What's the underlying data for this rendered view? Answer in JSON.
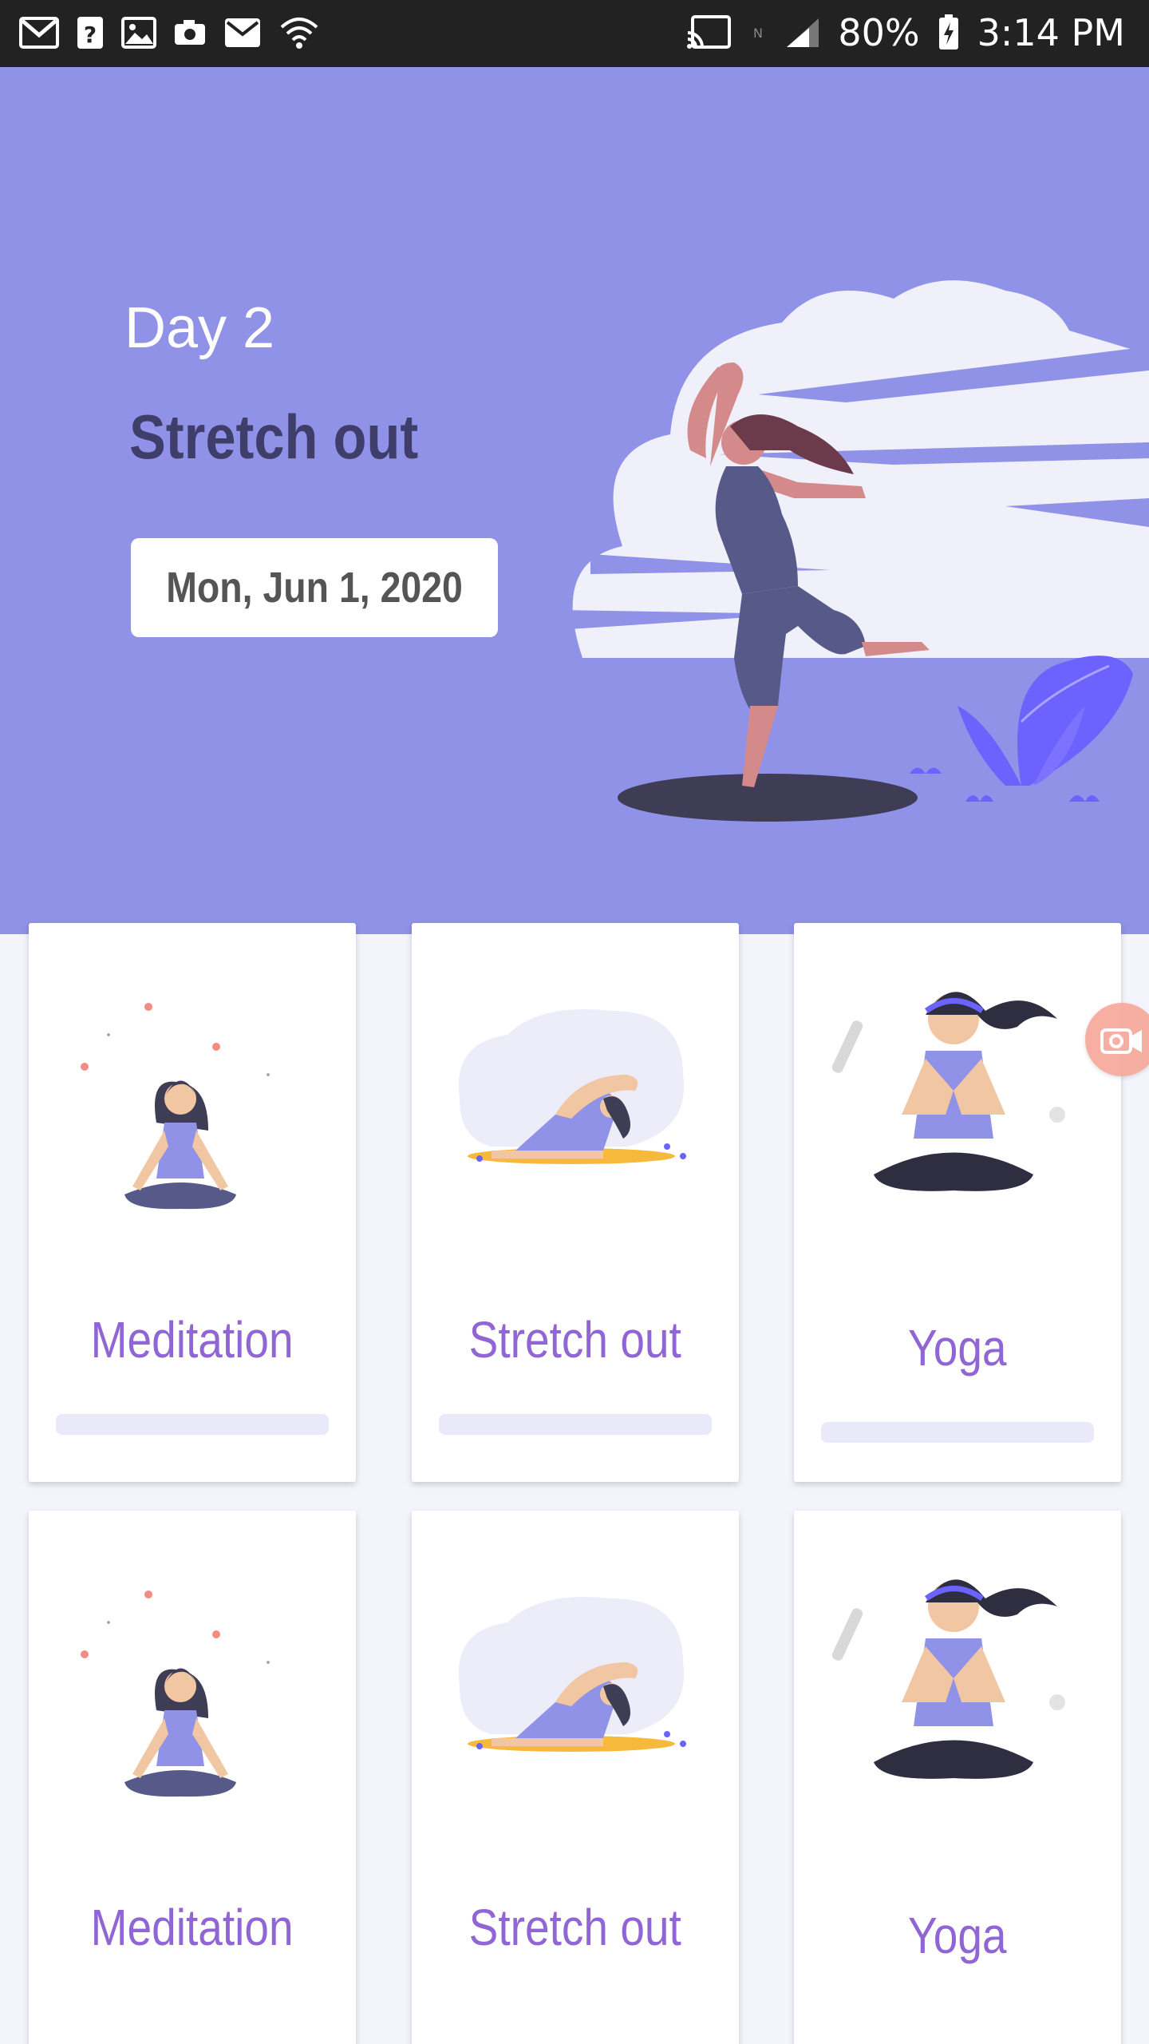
{
  "status_bar": {
    "battery": "80%",
    "time": "3:14 PM",
    "left_icons": [
      "gmail-icon",
      "help-icon",
      "image-icon",
      "camera-icon",
      "mail-icon",
      "wifi-icon"
    ],
    "right_icons": [
      "cast-icon",
      "nfc-icon",
      "signal-icon",
      "battery-charging-icon"
    ]
  },
  "hero": {
    "day_label": "Day 2",
    "title": "Stretch out",
    "date": "Mon, Jun 1, 2020",
    "background_color": "#8f92e7"
  },
  "cards": [
    {
      "label": "Meditation",
      "illustration": "meditation-illustration",
      "progress": 0
    },
    {
      "label": "Stretch out",
      "illustration": "stretch-illustration",
      "progress": 0
    },
    {
      "label": "Yoga",
      "illustration": "yoga-illustration",
      "progress": 0
    },
    {
      "label": "Meditation",
      "illustration": "meditation-illustration",
      "progress": 0
    },
    {
      "label": "Stretch out",
      "illustration": "stretch-illustration",
      "progress": 0
    },
    {
      "label": "Yoga",
      "illustration": "yoga-illustration",
      "progress": 0
    }
  ],
  "floating_button": {
    "icon": "screen-record-camera-icon"
  },
  "colors": {
    "accent": "#9066d6",
    "hero_text_dark": "#3f3e6b",
    "card_bar": "#e9e9f9"
  }
}
